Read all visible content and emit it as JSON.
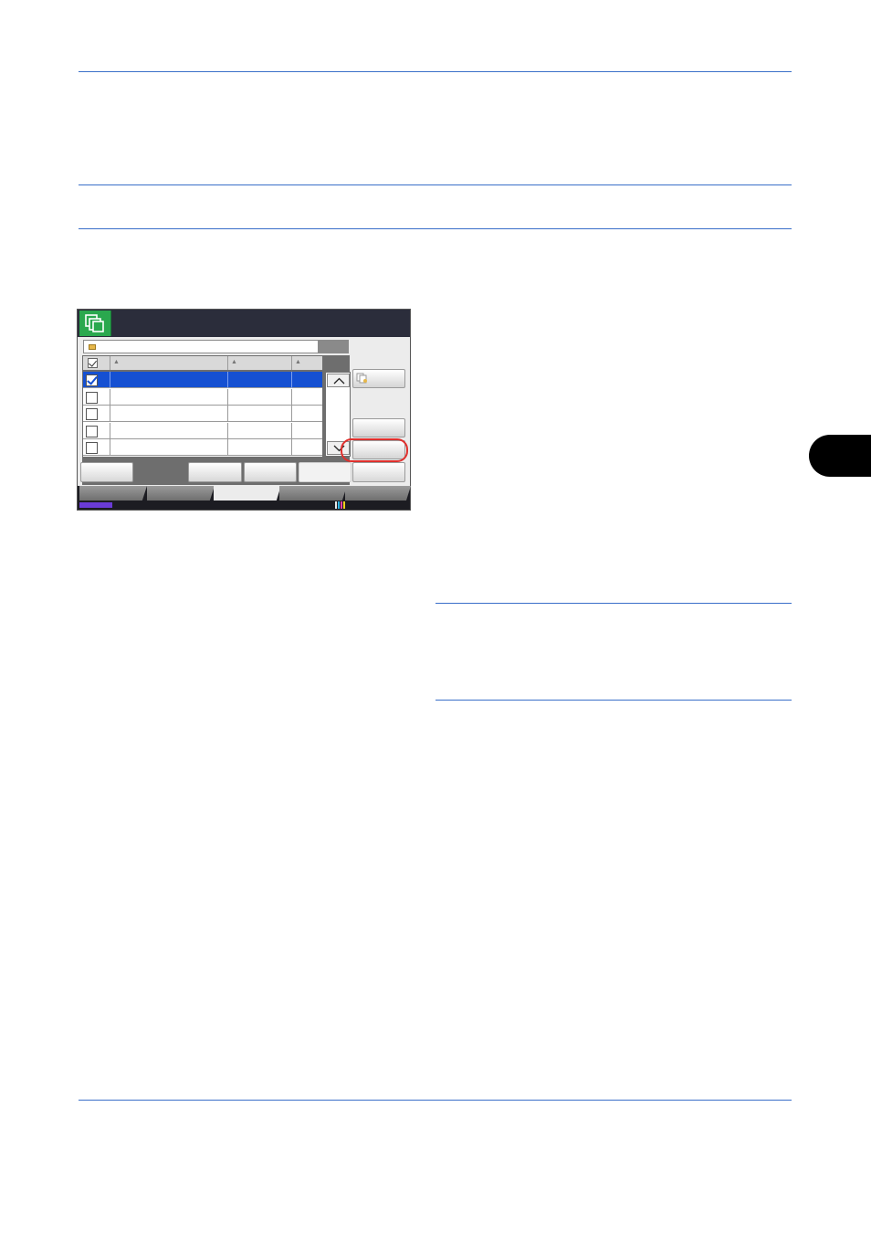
{
  "colors": {
    "rule": "#3a6fc9",
    "app_icon": "#2aa84e",
    "selection": "#1550d2",
    "highlight_ring": "#e0302d",
    "progress": "#6a3bd6",
    "chapter_tab": "#000000"
  },
  "icons": [
    "document-box-icon",
    "folder-icon",
    "select-all-checkbox-icon",
    "scroll-up-icon",
    "scroll-down-icon",
    "document-action-icon",
    "toner-level-icon"
  ],
  "panel": {
    "list_rows": [
      {
        "checked": true,
        "selected": true
      },
      {
        "checked": false,
        "selected": false
      },
      {
        "checked": false,
        "selected": false
      },
      {
        "checked": false,
        "selected": false
      },
      {
        "checked": false,
        "selected": false
      }
    ],
    "progress_fraction": 0.1
  }
}
